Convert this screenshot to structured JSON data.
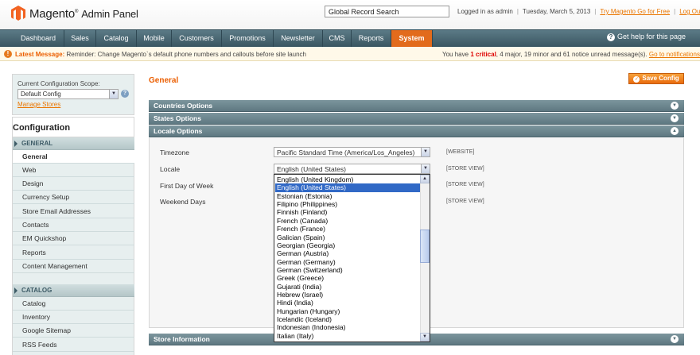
{
  "header": {
    "brand_magento": "Magento",
    "brand_suffix": "Admin Panel",
    "search_value": "Global Record Search",
    "logged_in": "Logged in as admin",
    "date": "Tuesday, March 5, 2013",
    "try_link": "Try Magento Go for Free",
    "logout": "Log Out"
  },
  "nav": {
    "items": [
      "Dashboard",
      "Sales",
      "Catalog",
      "Mobile",
      "Customers",
      "Promotions",
      "Newsletter",
      "CMS",
      "Reports",
      "System"
    ],
    "active": "System",
    "help": "Get help for this page"
  },
  "message": {
    "label": "Latest Message:",
    "text": "Reminder: Change Magento`s default phone numbers and callouts before site launch",
    "summary_prefix": "You have",
    "critical_count": "1",
    "critical_label": "critical",
    "rest": ", 4 major, 19 minor and 61 notice unread message(s).",
    "link": "Go to notifications"
  },
  "scope": {
    "label": "Current Configuration Scope:",
    "value": "Default Config",
    "manage_link": "Manage Stores"
  },
  "sidebar": {
    "title": "Configuration",
    "general_head": "GENERAL",
    "general_items": [
      "General",
      "Web",
      "Design",
      "Currency Setup",
      "Store Email Addresses",
      "Contacts",
      "EM Quickshop",
      "Reports",
      "Content Management"
    ],
    "active_item": "General",
    "catalog_head": "CATALOG",
    "catalog_items": [
      "Catalog",
      "Inventory",
      "Google Sitemap",
      "RSS Feeds"
    ]
  },
  "main": {
    "title": "General",
    "save_button": "Save Config",
    "sections": [
      "Countries Options",
      "States Options",
      "Locale Options",
      "Store Information"
    ],
    "fields": [
      {
        "label": "Timezone",
        "value": "Pacific Standard Time (America/Los_Angeles)",
        "scope": "[WEBSITE]"
      },
      {
        "label": "Locale",
        "value": "English (United States)",
        "scope": "[STORE VIEW]"
      },
      {
        "label": "First Day of Week",
        "value": "",
        "scope": "[STORE VIEW]"
      },
      {
        "label": "Weekend Days",
        "value": "",
        "scope": "[STORE VIEW]"
      }
    ],
    "locale_options": [
      "English (United Kingdom)",
      "English (United States)",
      "Estonian (Estonia)",
      "Filipino (Philippines)",
      "Finnish (Finland)",
      "French (Canada)",
      "French (France)",
      "Galician (Spain)",
      "Georgian (Georgia)",
      "German (Austria)",
      "German (Germany)",
      "German (Switzerland)",
      "Greek (Greece)",
      "Gujarati (India)",
      "Hebrew (Israel)",
      "Hindi (India)",
      "Hungarian (Hungary)",
      "Icelandic (Iceland)",
      "Indonesian (Indonesia)",
      "Italian (Italy)"
    ],
    "selected_locale": "English (United States)"
  },
  "colors": {
    "accent": "#eb5e00",
    "nav_bg": "#4a6772",
    "active_tab": "#e26b1c",
    "selected_option": "#3169c6"
  }
}
